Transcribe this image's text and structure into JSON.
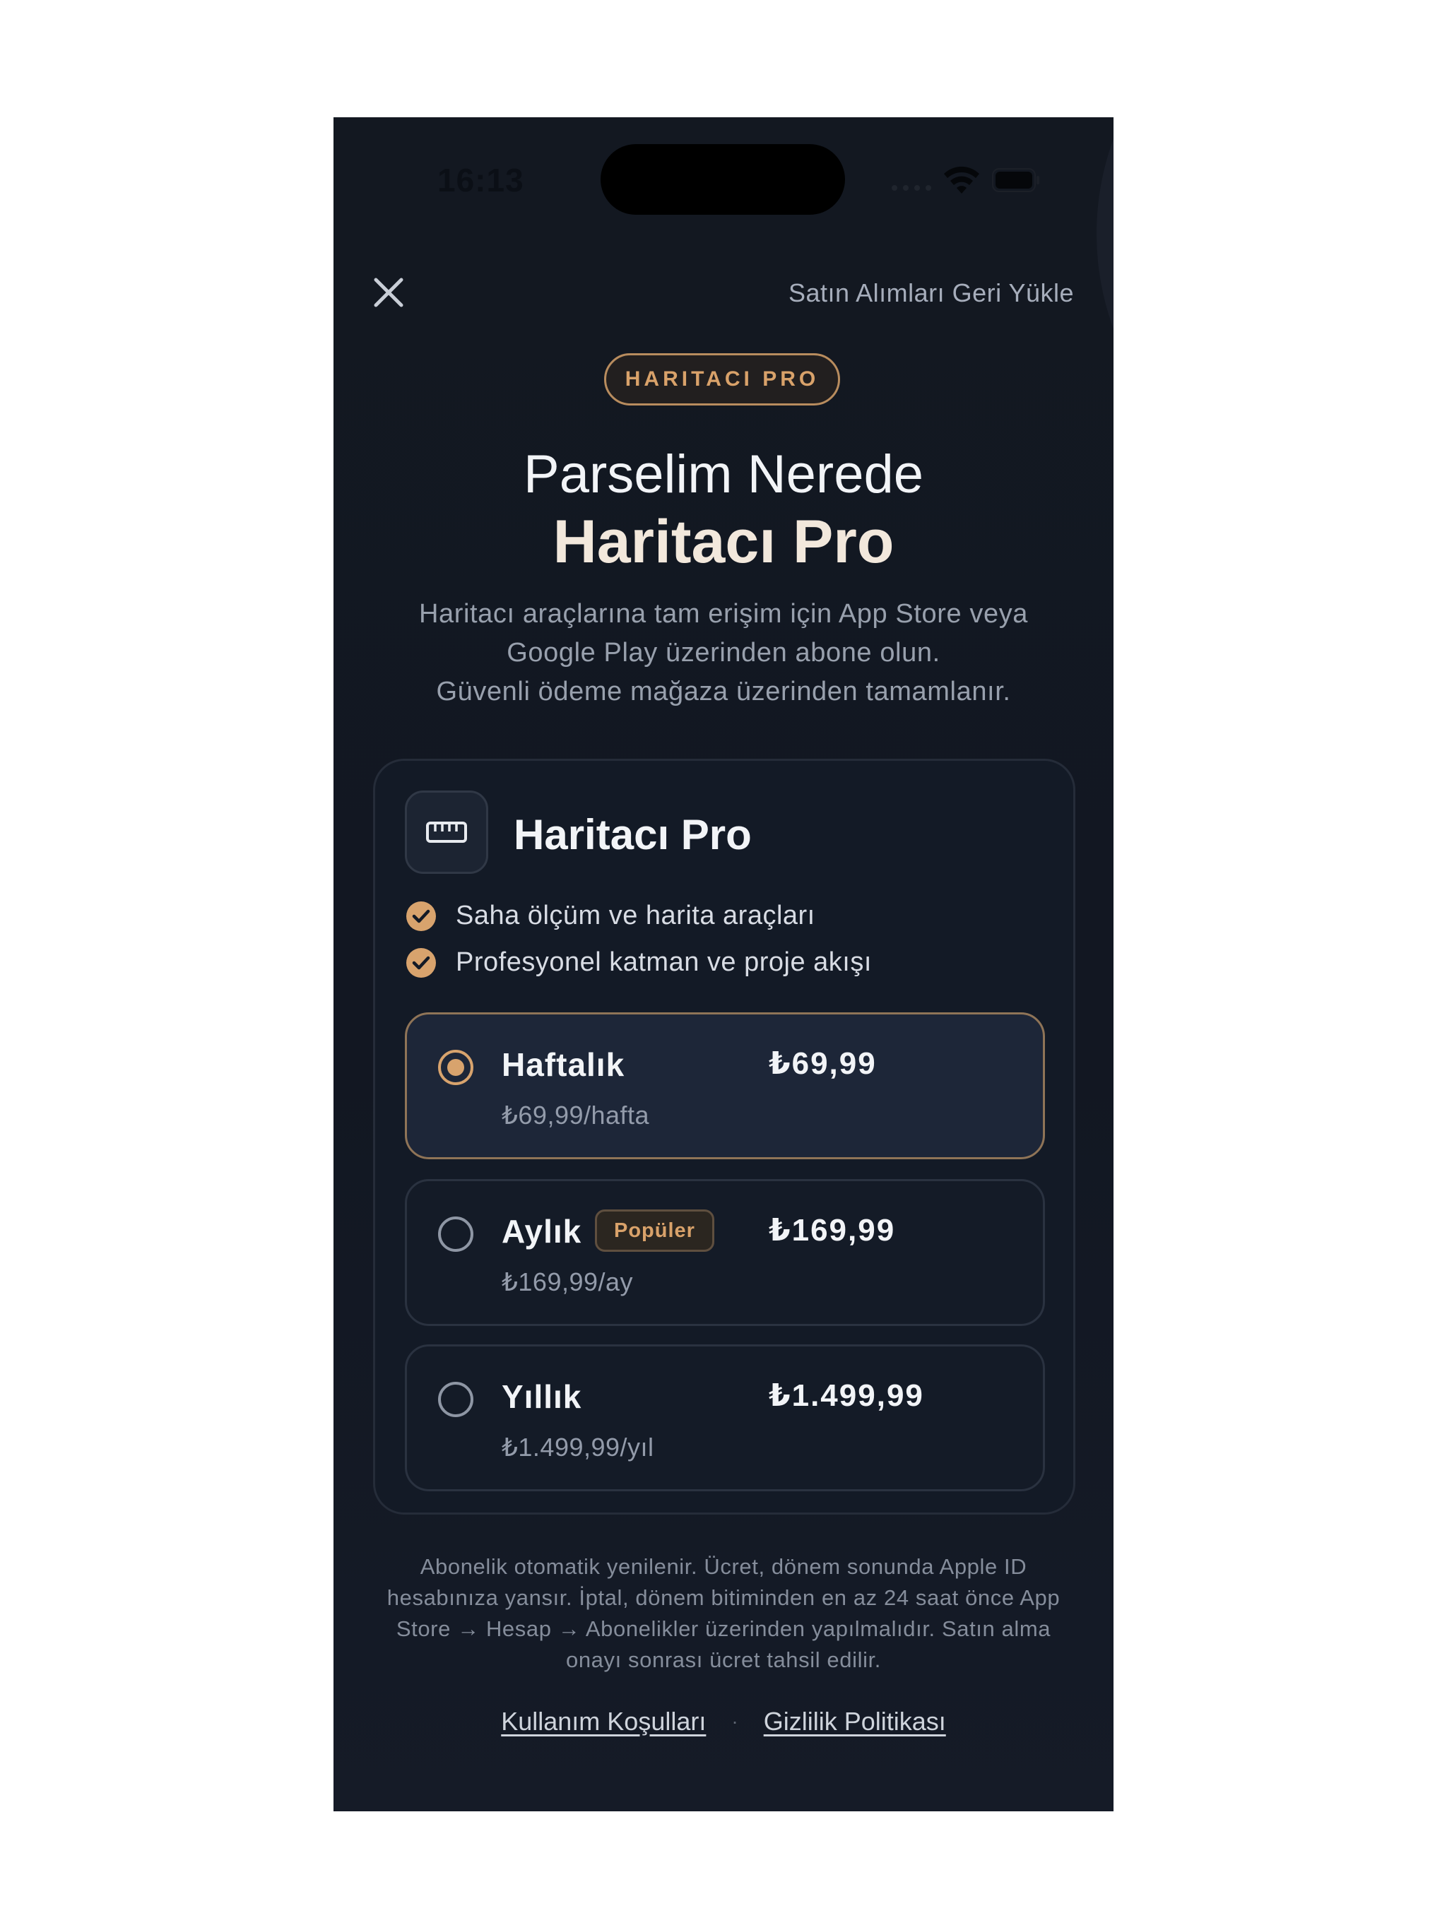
{
  "status_bar": {
    "time": "16:13",
    "icons": [
      "signal-icon",
      "wifi-icon",
      "battery-icon"
    ]
  },
  "header": {
    "close_icon": "close-icon",
    "restore_label": "Satın Alımları Geri Yükle"
  },
  "badge": "HARITACI PRO",
  "title": {
    "line1": "Parselim Nerede",
    "line2": "Haritacı Pro"
  },
  "subtitle": [
    "Haritacı araçlarına tam erişim için App Store veya",
    "Google Play üzerinden abone olun.",
    "Güvenli ödeme mağaza üzerinden tamamlanır."
  ],
  "card": {
    "icon": "ruler-icon",
    "title": "Haritacı Pro",
    "features": [
      "Saha ölçüm ve harita araçları",
      "Profesyonel katman ve proje akışı"
    ],
    "plans": [
      {
        "name": "Haftalık",
        "price": "₺69,99",
        "sub": "₺69,99/hafta",
        "selected": true,
        "badge": ""
      },
      {
        "name": "Aylık",
        "price": "₺169,99",
        "sub": "₺169,99/ay",
        "selected": false,
        "badge": "Popüler"
      },
      {
        "name": "Yıllık",
        "price": "₺1.499,99",
        "sub": "₺1.499,99/yıl",
        "selected": false,
        "badge": ""
      }
    ]
  },
  "legal": [
    "Abonelik otomatik yenilenir. Ücret, dönem sonunda Apple ID",
    "hesabınıza yansır. İptal, dönem bitiminden en az 24 saat önce App",
    "Store → Hesap → Abonelikler üzerinden yapılmalıdır. Satın alma",
    "onayı sonrası ücret tahsil edilir."
  ],
  "links": {
    "terms": "Kullanım Koşulları",
    "separator": "·",
    "privacy": "Gizlilik Politikası"
  },
  "colors": {
    "accent": "#d8a36d",
    "background": "#131821",
    "card": "#131a26",
    "selected_plan": "#1d2638"
  }
}
